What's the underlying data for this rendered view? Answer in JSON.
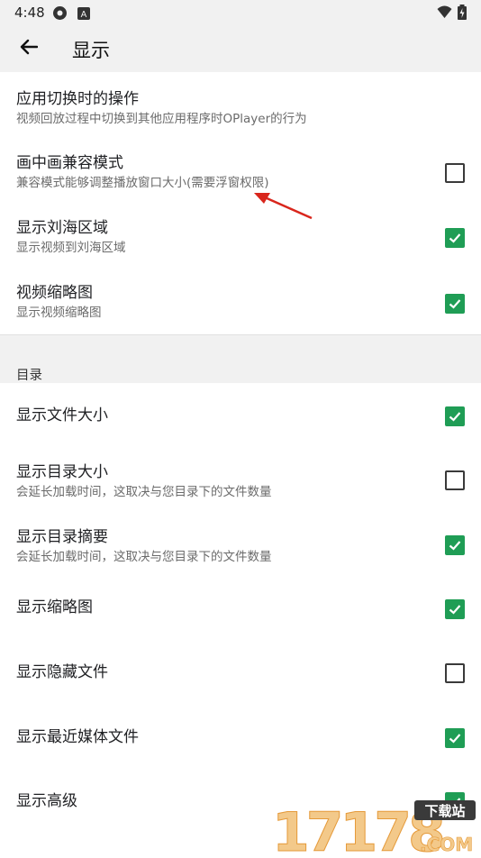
{
  "status": {
    "time": "4:48",
    "icon_left": "settings-icon",
    "icon_a": "A",
    "wifi": "wifi-icon",
    "battery": "battery-charging-icon"
  },
  "appbar": {
    "title": "显示",
    "back_icon": "back-arrow-icon"
  },
  "rows": [
    {
      "title": "应用切换时的操作",
      "subtitle": "视频回放过程中切换到其他应用程序时OPlayer的行为",
      "checkbox": null
    },
    {
      "title": "画中画兼容模式",
      "subtitle": "兼容模式能够调整播放窗口大小(需要浮窗权限)",
      "checkbox": false
    },
    {
      "title": "显示刘海区域",
      "subtitle": "显示视频到刘海区域",
      "checkbox": true
    },
    {
      "title": "视频缩略图",
      "subtitle": "显示视频缩略图",
      "checkbox": true
    }
  ],
  "section": {
    "label": "目录"
  },
  "dir_rows": [
    {
      "title": "显示文件大小",
      "subtitle": "",
      "checkbox": true
    },
    {
      "title": "显示目录大小",
      "subtitle": "会延长加载时间，这取决与您目录下的文件数量",
      "checkbox": false
    },
    {
      "title": "显示目录摘要",
      "subtitle": "会延长加载时间，这取决与您目录下的文件数量",
      "checkbox": true
    },
    {
      "title": "显示缩略图",
      "subtitle": "",
      "checkbox": true
    },
    {
      "title": "显示隐藏文件",
      "subtitle": "",
      "checkbox": false
    },
    {
      "title": "显示最近媒体文件",
      "subtitle": "",
      "checkbox": true
    },
    {
      "title": "显示高级",
      "subtitle": "",
      "checkbox": true
    }
  ],
  "watermark": {
    "main": "17178",
    "tag": "下载站",
    "com": ".COM"
  },
  "colors": {
    "check_green": "#1f9d55",
    "annotation_red": "#d9261c",
    "bar_bg": "#f1f1f1"
  }
}
